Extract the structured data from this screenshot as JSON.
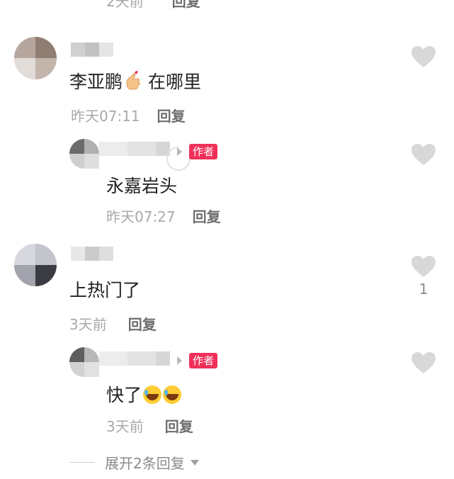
{
  "top_row": {
    "time": "2天前",
    "reply_label": "回复"
  },
  "comments": [
    {
      "text": "李亚鹏",
      "text_suffix": "在哪里",
      "time": "昨天07:11",
      "reply_label": "回复",
      "likes": ""
    },
    {
      "text": "永嘉岩头",
      "time": "昨天07:27",
      "reply_label": "回复",
      "badge": "作者",
      "likes": ""
    },
    {
      "text": "上热门了",
      "time": "3天前",
      "reply_label": "回复",
      "likes": "1"
    },
    {
      "text": "快了",
      "time": "3天前",
      "reply_label": "回复",
      "badge": "作者",
      "likes": ""
    }
  ],
  "expand": {
    "label": "展开2条回复"
  },
  "colors": {
    "badge": "#f0305a",
    "heart": "#d8d8d8",
    "text": "#222222",
    "muted": "#a9a9a9"
  },
  "icons": [
    "heart-icon",
    "finger-heart-emoji-icon",
    "laughing-emoji-icon",
    "reply-arrow-icon",
    "caret-down-icon"
  ]
}
